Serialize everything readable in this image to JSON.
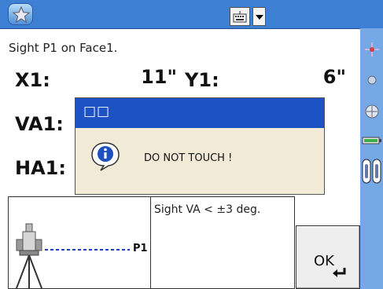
{
  "taskbar": {
    "start_icon": "star-icon",
    "keyboard_icon": "keyboard-icon",
    "dropdown_icon": "chevron-down-icon"
  },
  "sidepanel": {
    "icons": [
      "crosshair-icon",
      "dot-icon",
      "target-icon",
      "battery-icon",
      "prism-icon"
    ]
  },
  "main": {
    "instruction": "Sight P1 on Face1.",
    "x_label": "X1:",
    "x_value": "11\"",
    "y_label": "Y1:",
    "y_value": "6\"",
    "va_label": "VA1:",
    "ha_label": "HA1:"
  },
  "dialog": {
    "title": "□□",
    "icon": "info-icon",
    "message": "DO NOT TOUCH !"
  },
  "bottom": {
    "point_label": "P1",
    "note": "Sight VA < ±3 deg.",
    "ok_label": "OK",
    "enter_icon": "enter-arrow-icon"
  },
  "colors": {
    "taskbar": "#3d7fd3",
    "sidepanel": "#74a9e6",
    "dialog_title": "#1c52c4",
    "dialog_body": "#f0ead7"
  }
}
